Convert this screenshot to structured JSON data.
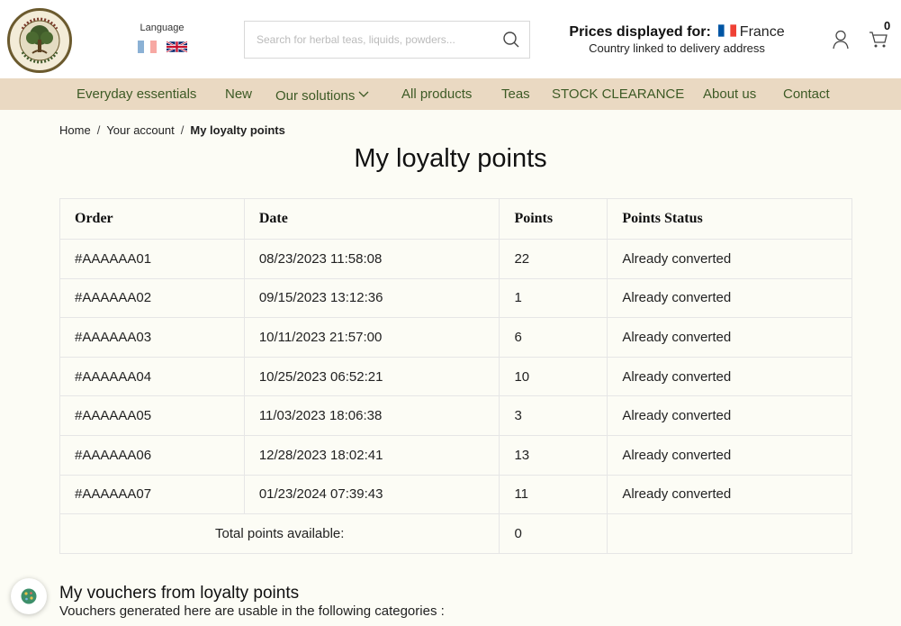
{
  "header": {
    "language_label": "Language",
    "search_placeholder": "Search for herbal teas, liquids, powders...",
    "prices_label": "Prices displayed for:",
    "country": "France",
    "prices_sub": "Country linked to delivery address",
    "cart_count": "0"
  },
  "nav": {
    "items": [
      "Everyday essentials",
      "New",
      "Our solutions",
      "All products",
      "Teas",
      "STOCK CLEARANCE",
      "About us",
      "Contact"
    ]
  },
  "breadcrumb": {
    "home": "Home",
    "account": "Your account",
    "sep": "/",
    "current": "My loyalty points"
  },
  "page_title": "My loyalty points",
  "table": {
    "headers": [
      "Order",
      "Date",
      "Points",
      "Points Status"
    ],
    "rows": [
      [
        "#AAAAAA01",
        "08/23/2023 11:58:08",
        "22",
        "Already converted"
      ],
      [
        "#AAAAAA02",
        "09/15/2023 13:12:36",
        "1",
        "Already converted"
      ],
      [
        "#AAAAAA03",
        "10/11/2023 21:57:00",
        "6",
        "Already converted"
      ],
      [
        "#AAAAAA04",
        "10/25/2023 06:52:21",
        "10",
        "Already converted"
      ],
      [
        "#AAAAAA05",
        "11/03/2023 18:06:38",
        "3",
        "Already converted"
      ],
      [
        "#AAAAAA06",
        "12/28/2023 18:02:41",
        "13",
        "Already converted"
      ],
      [
        "#AAAAAA07",
        "01/23/2024 07:39:43",
        "11",
        "Already converted"
      ]
    ],
    "total_label": "Total points available:",
    "total_value": "0"
  },
  "vouchers": {
    "title": "My vouchers from loyalty points",
    "text": "Vouchers generated here are usable in the following categories :"
  },
  "colors": {
    "nav_bg": "#ead9c2",
    "nav_text": "#3d5a25",
    "page_bg": "#fcfcf5"
  }
}
